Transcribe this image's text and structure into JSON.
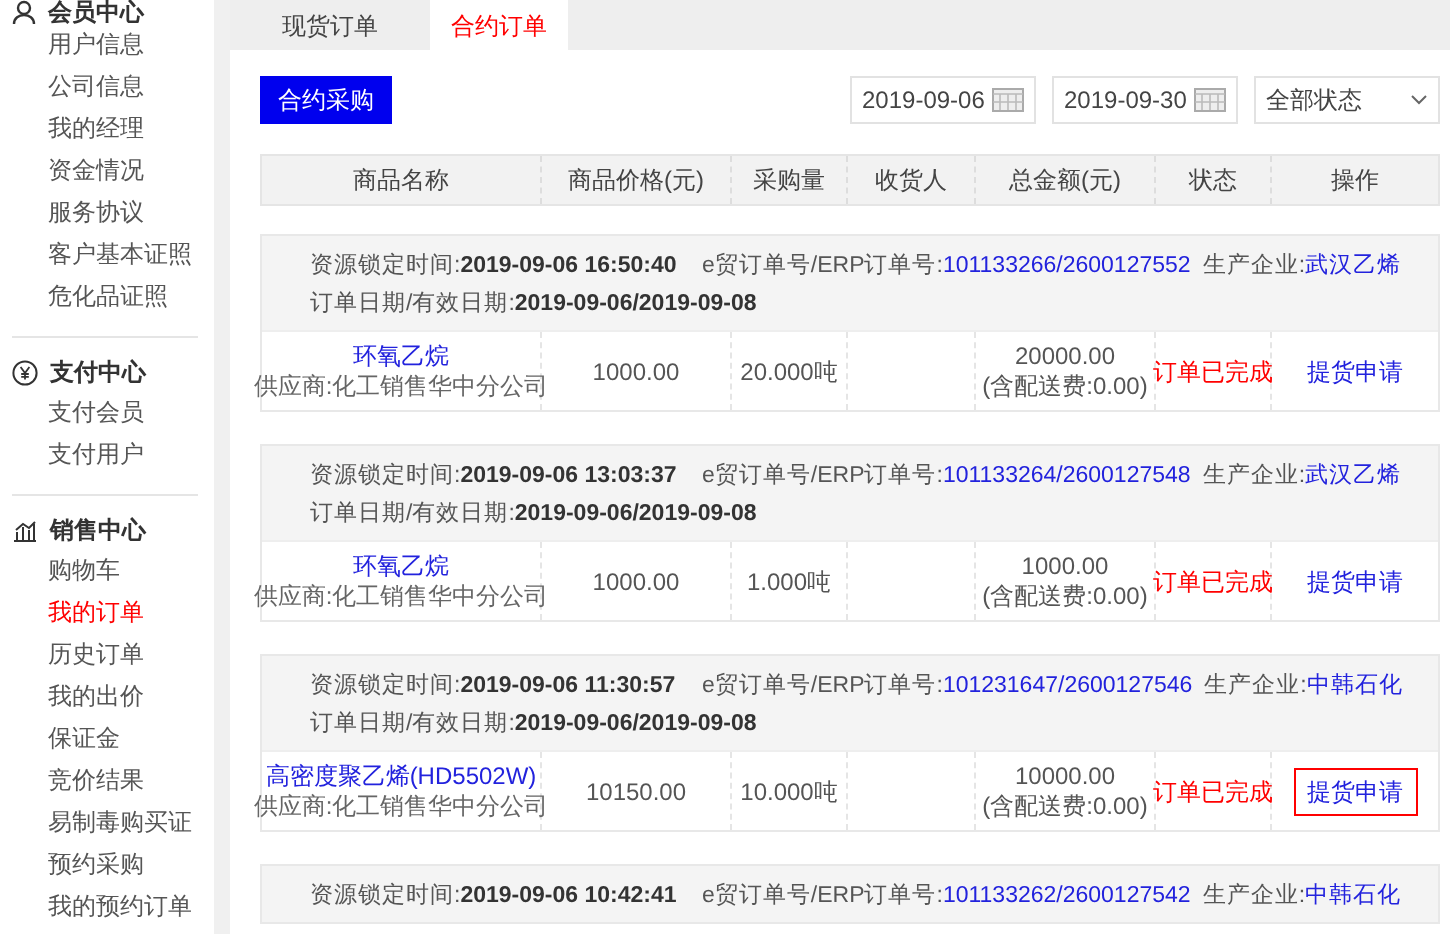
{
  "sidebar": {
    "groups": [
      {
        "kind": "user",
        "title": "会员中心",
        "items": [
          {
            "label": "用户信息",
            "selected": false
          },
          {
            "label": "公司信息",
            "selected": false
          },
          {
            "label": "我的经理",
            "selected": false
          },
          {
            "label": "资金情况",
            "selected": false
          },
          {
            "label": "服务协议",
            "selected": false
          },
          {
            "label": "客户基本证照",
            "selected": false
          },
          {
            "label": "危化品证照",
            "selected": false
          }
        ]
      },
      {
        "kind": "pay",
        "title": "支付中心",
        "items": [
          {
            "label": "支付会员",
            "selected": false
          },
          {
            "label": "支付用户",
            "selected": false
          }
        ]
      },
      {
        "kind": "sales",
        "title": "销售中心",
        "items": [
          {
            "label": "购物车",
            "selected": false
          },
          {
            "label": "我的订单",
            "selected": true
          },
          {
            "label": "历史订单",
            "selected": false
          },
          {
            "label": "我的出价",
            "selected": false
          },
          {
            "label": "保证金",
            "selected": false
          },
          {
            "label": "竞价结果",
            "selected": false
          },
          {
            "label": "易制毒购买证",
            "selected": false
          },
          {
            "label": "预约采购",
            "selected": false
          },
          {
            "label": "我的预约订单",
            "selected": false
          }
        ]
      }
    ]
  },
  "tabs": [
    {
      "label": "现货订单",
      "selected": false
    },
    {
      "label": "合约订单",
      "selected": true
    }
  ],
  "toolbar": {
    "button": "合约采购",
    "start_date": "2019-09-06",
    "end_date": "2019-09-30",
    "status_filter": "全部状态"
  },
  "table": {
    "columns": [
      "商品名称",
      "商品价格(元)",
      "采购量",
      "收货人",
      "总金额(元)",
      "状态",
      "操作"
    ]
  },
  "orders": [
    {
      "lock_label": "资源锁定时间:",
      "lock_time": "2019-09-06 16:50:40",
      "order_no_label": "e贸订单号/ERP订单号:",
      "order_no": "101133266/2600127552",
      "producer_label": "生产企业:",
      "producer": "武汉乙烯",
      "date_label": "订单日期/有效日期:",
      "dates": "2019-09-06/2019-09-08",
      "product": "环氧乙烷",
      "supplier": "供应商:化工销售华中分公司",
      "price": "1000.00",
      "quantity": "20.000吨",
      "total": "20000.00",
      "fee": "(含配送费:0.00)",
      "status": "订单已完成",
      "action": "提货申请",
      "focused": false
    },
    {
      "lock_label": "资源锁定时间:",
      "lock_time": "2019-09-06 13:03:37",
      "order_no_label": "e贸订单号/ERP订单号:",
      "order_no": "101133264/2600127548",
      "producer_label": "生产企业:",
      "producer": "武汉乙烯",
      "date_label": "订单日期/有效日期:",
      "dates": "2019-09-06/2019-09-08",
      "product": "环氧乙烷",
      "supplier": "供应商:化工销售华中分公司",
      "price": "1000.00",
      "quantity": "1.000吨",
      "total": "1000.00",
      "fee": "(含配送费:0.00)",
      "status": "订单已完成",
      "action": "提货申请",
      "focused": false
    },
    {
      "lock_label": "资源锁定时间:",
      "lock_time": "2019-09-06 11:30:57",
      "order_no_label": "e贸订单号/ERP订单号:",
      "order_no": "101231647/2600127546",
      "producer_label": "生产企业:",
      "producer": "中韩石化",
      "date_label": "订单日期/有效日期:",
      "dates": "2019-09-06/2019-09-08",
      "product": "高密度聚乙烯(HD5502W)",
      "supplier": "供应商:化工销售华中分公司",
      "price": "10150.00",
      "quantity": "10.000吨",
      "total": "10000.00",
      "fee": "(含配送费:0.00)",
      "status": "订单已完成",
      "action": "提货申请",
      "focused": true
    },
    {
      "lock_label": "资源锁定时间:",
      "lock_time": "2019-09-06 10:42:41",
      "order_no_label": "e贸订单号/ERP订单号:",
      "order_no": "101133262/2600127542",
      "producer_label": "生产企业:",
      "producer": "中韩石化"
    }
  ]
}
